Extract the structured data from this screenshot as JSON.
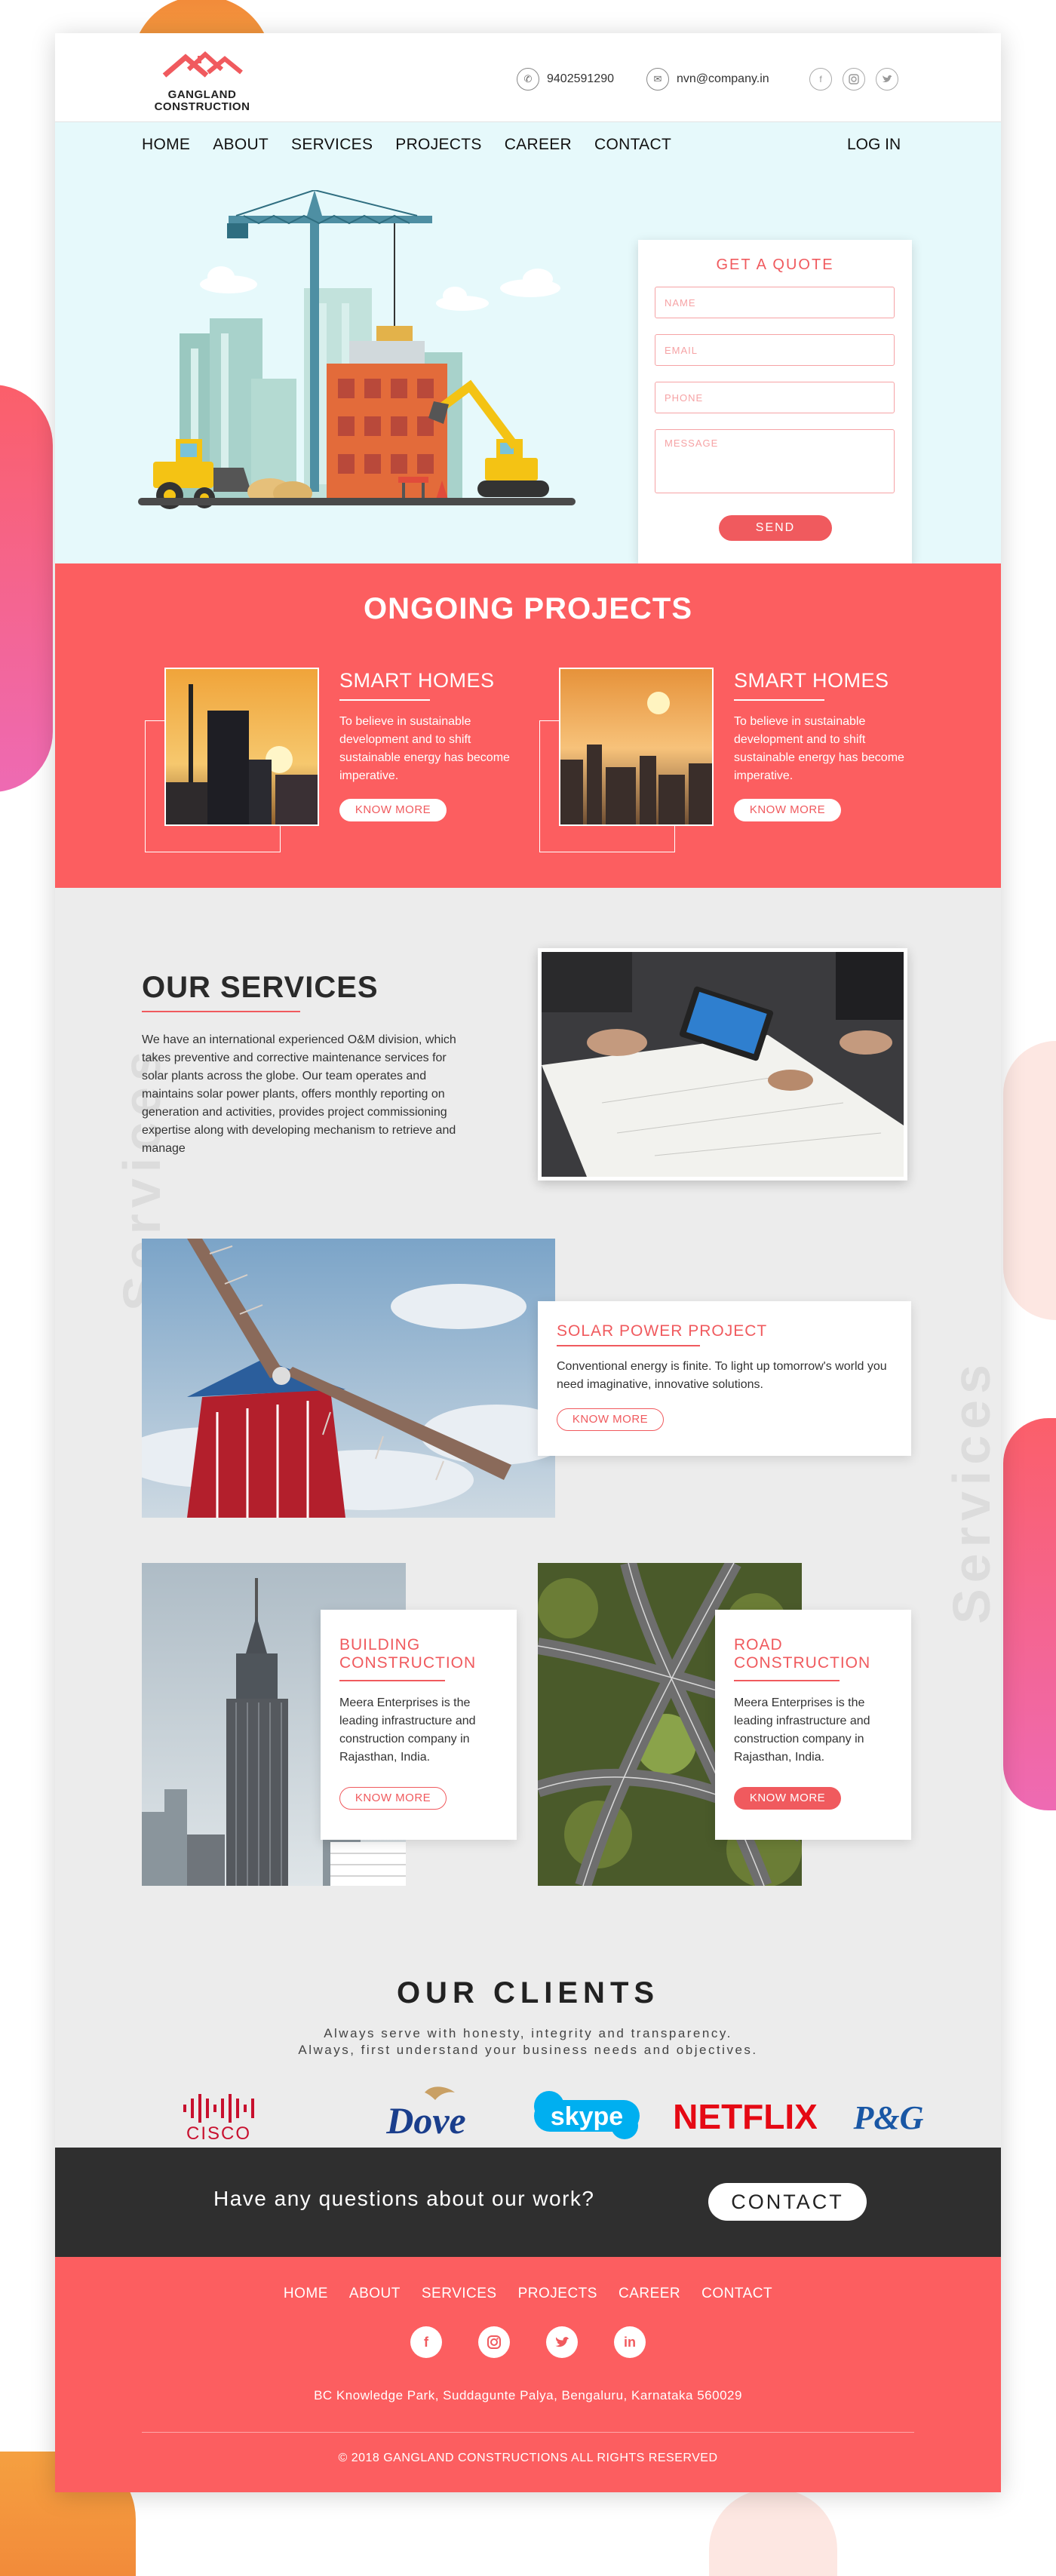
{
  "header": {
    "brand": "GANGLAND CONSTRUCTION",
    "brand_line1": "GANGLAND",
    "brand_line2": "CONSTRUCTION",
    "phone": "9402591290",
    "email": "nvn@company.in",
    "social": [
      "facebook-icon",
      "instagram-icon",
      "twitter-icon"
    ]
  },
  "nav": {
    "items": [
      "HOME",
      "ABOUT",
      "SERVICES",
      "PROJECTS",
      "CAREER",
      "CONTACT"
    ],
    "login": "LOG IN"
  },
  "quote": {
    "title": "GET A QUOTE",
    "name_placeholder": "NAME",
    "email_placeholder": "EMAIL",
    "phone_placeholder": "PHONE",
    "message_placeholder": "MESSAGE",
    "send": "SEND"
  },
  "ongoing": {
    "title": "ONGOING PROJECTS",
    "projects": [
      {
        "title": "SMART HOMES",
        "text": "To believe in sustainable development and to shift sustainable energy has become imperative.",
        "button": "KNOW MORE"
      },
      {
        "title": "SMART HOMES",
        "text": "To believe in sustainable development and to shift sustainable energy has become imperative.",
        "button": "KNOW MORE"
      }
    ]
  },
  "services": {
    "watermark": "Services",
    "title": "OUR SERVICES",
    "text": "We have an international experienced O&M division, which takes preventive and corrective maintenance services for solar plants across the globe. Our team operates and maintains solar power plants, offers monthly reporting on generation and activities, provides project commissioning expertise along with developing mechanism to retrieve and manage",
    "solar": {
      "title": "SOLAR POWER PROJECT",
      "text": "Conventional energy is finite. To light up tomorrow's world you need imaginative, innovative solutions.",
      "button": "KNOW MORE"
    },
    "building": {
      "title_line1": "BUILDING",
      "title_line2": "CONSTRUCTION",
      "text": "Meera Enterprises is the leading infrastructure and construction company in Rajasthan, India.",
      "button": "KNOW MORE"
    },
    "road": {
      "title_line1": "ROAD",
      "title_line2": "CONSTRUCTION",
      "text": "Meera Enterprises is the leading infrastructure and construction company in Rajasthan, India.",
      "button": "KNOW MORE"
    }
  },
  "clients": {
    "title": "OUR CLIENTS",
    "sub_line1": "Always serve with honesty, integrity and transparency.",
    "sub_line2": "Always, first understand your business needs and objectives.",
    "logos": [
      "CISCO",
      "Dove",
      "skype",
      "NETFLIX",
      "P&G"
    ]
  },
  "cta": {
    "text": "Have any questions about our work?",
    "button": "CONTACT"
  },
  "footer": {
    "nav": [
      "HOME",
      "ABOUT",
      "SERVICES",
      "PROJECTS",
      "CAREER",
      "CONTACT"
    ],
    "social": [
      "facebook-icon",
      "instagram-icon",
      "twitter-icon",
      "linkedin-icon"
    ],
    "address": "BC Knowledge Park, Suddagunte Palya, Bengaluru, Karnataka 560029",
    "copyright": "© 2018 GANGLAND CONSTRUCTIONS ALL RIGHTS RESERVED"
  },
  "colors": {
    "accent": "#f05a5e",
    "section_red": "#fc5e60",
    "hero_bg": "#e6f9fb",
    "services_bg": "#ececec",
    "cta_bg": "#2f2f2f"
  }
}
